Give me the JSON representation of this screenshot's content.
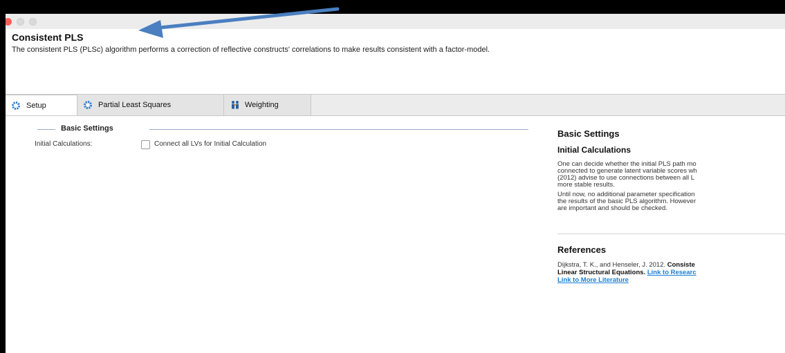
{
  "header": {
    "title": "Consistent PLS",
    "description": "The consistent PLS (PLSc) algorithm performs a correction of reflective constructs' correlations to make results consistent with a factor-model."
  },
  "tabs": [
    {
      "label": "Setup",
      "icon": "gear-icon",
      "active": true
    },
    {
      "label": "Partial Least Squares",
      "icon": "gear-icon",
      "active": false
    },
    {
      "label": "Weighting",
      "icon": "people-icon",
      "active": false
    }
  ],
  "settings": {
    "section_title": "Basic Settings",
    "initial_label": "Initial Calculations:",
    "checkbox_label": "Connect all LVs for Initial Calculation",
    "checkbox_checked": false
  },
  "help": {
    "title": "Basic Settings",
    "subtitle": "Initial Calculations",
    "para1": "One can decide whether the initial PLS path mo\nconnected to generate latent variable scores wh\n(2012) advise to use connections between all L\nmore stable results.",
    "para2": "Until now, no additional parameter specification\nthe results of the basic PLS algorithm. However\nare important and should be checked.",
    "references_title": "References",
    "ref_text": "Dijkstra, T. K., and Henseler, J. 2012. ",
    "ref_bold1": "Consiste",
    "ref_bold2": "Linear Structural Equations. ",
    "ref_link1": "Link to Researc",
    "ref_link2": "Link to More Literature"
  },
  "colors": {
    "close": "#ff5f56",
    "link": "#1a7fd6",
    "arrow": "#4a7fc0",
    "tab_icon": "#2a7fd4"
  }
}
